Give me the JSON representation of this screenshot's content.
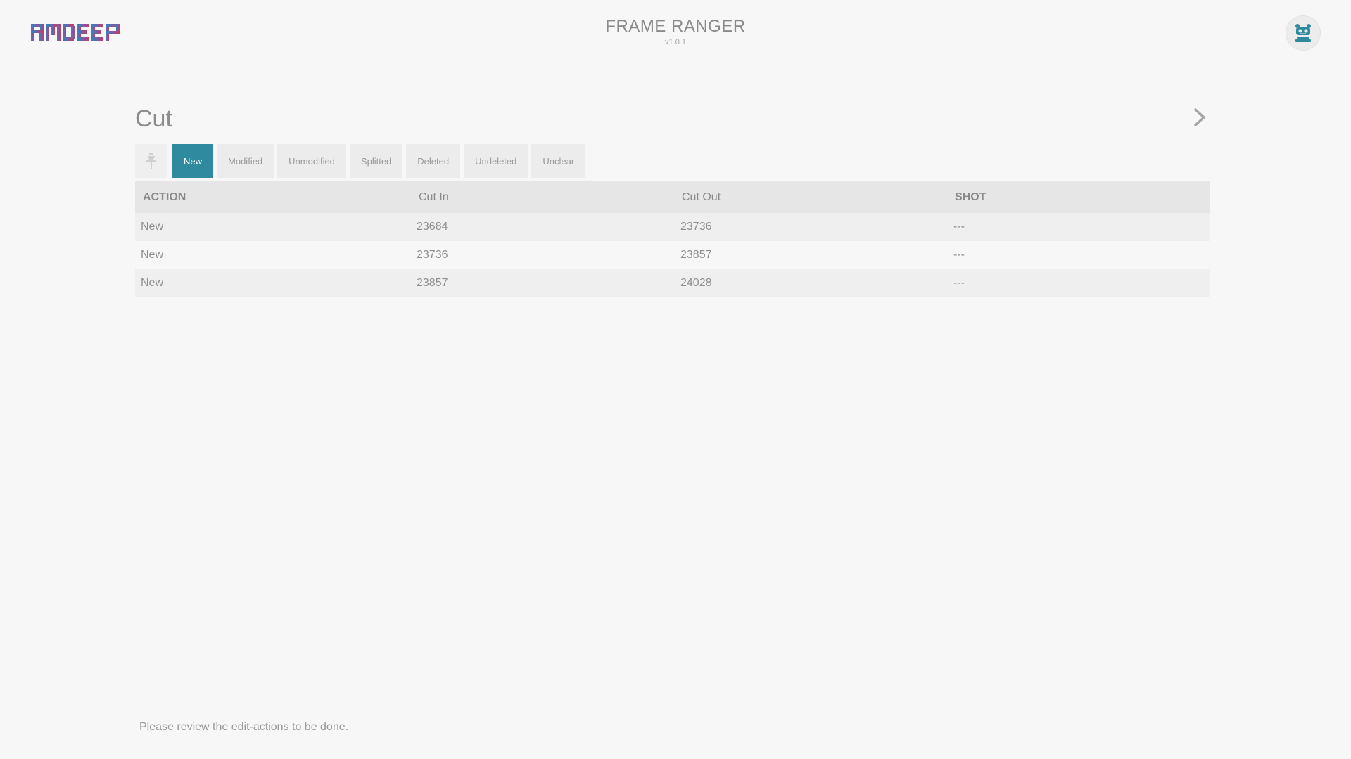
{
  "header": {
    "logo_text": "RMDEEP",
    "app_title": "FRAME RANGER",
    "version": "v1.0.1",
    "avatar_icon": "robot-icon"
  },
  "page": {
    "title": "Cut",
    "next_icon": "chevron-right-icon"
  },
  "filters": {
    "icon": "pin-icon",
    "buttons": [
      {
        "label": "New",
        "active": true
      },
      {
        "label": "Modified",
        "active": false
      },
      {
        "label": "Unmodified",
        "active": false
      },
      {
        "label": "Splitted",
        "active": false
      },
      {
        "label": "Deleted",
        "active": false
      },
      {
        "label": "Undeleted",
        "active": false
      },
      {
        "label": "Unclear",
        "active": false
      }
    ]
  },
  "table": {
    "headers": [
      "ACTION",
      "Cut In",
      "Cut Out",
      "SHOT"
    ],
    "rows": [
      [
        "New",
        "23684",
        "23736",
        "---"
      ],
      [
        "New",
        "23736",
        "23857",
        "---"
      ],
      [
        "New",
        "23857",
        "24028",
        "---"
      ]
    ]
  },
  "status": {
    "message": "Please review the edit-actions to be done."
  },
  "colors": {
    "accent": "#2f8aa0",
    "logo_blue": "#2e86c1",
    "logo_purple": "#7d5aa6",
    "logo_red": "#d8364f"
  }
}
